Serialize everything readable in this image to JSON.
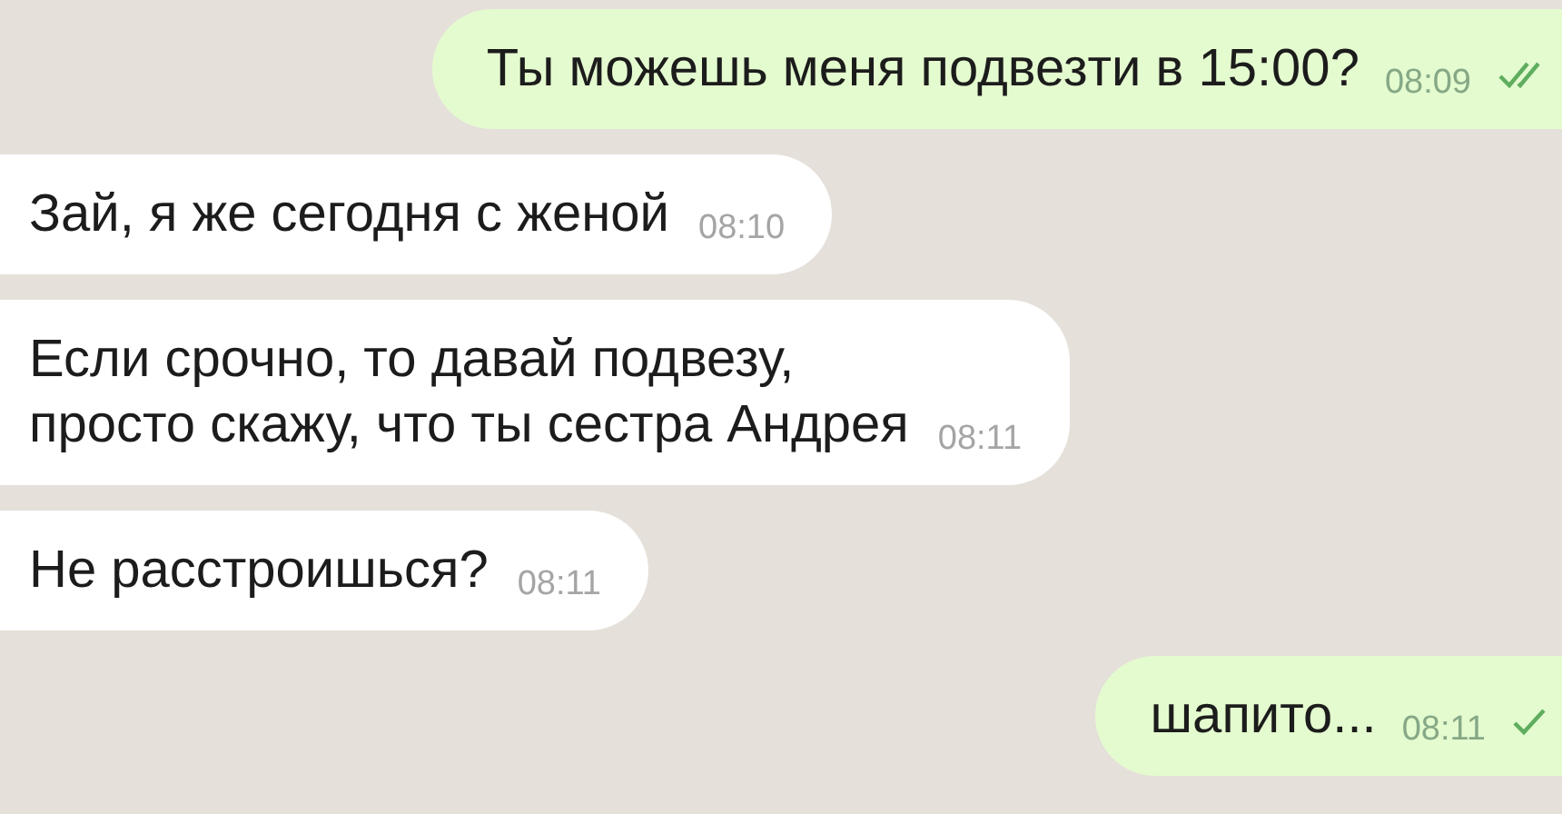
{
  "messages": [
    {
      "kind": "outgoing",
      "text": "Ты можешь меня подвезти в 15:00?",
      "time": "08:09",
      "read": true
    },
    {
      "kind": "incoming",
      "text": "Зай, я же сегодня с женой",
      "time": "08:10"
    },
    {
      "kind": "incoming",
      "text": "Если срочно, то давай подвезу,\nпросто скажу, что ты сестра Андрея",
      "time": "08:11"
    },
    {
      "kind": "incoming",
      "text": "Не расстроишься?",
      "time": "08:11"
    },
    {
      "kind": "outgoing",
      "text": "шапито...",
      "time": "08:11",
      "read": false
    }
  ]
}
